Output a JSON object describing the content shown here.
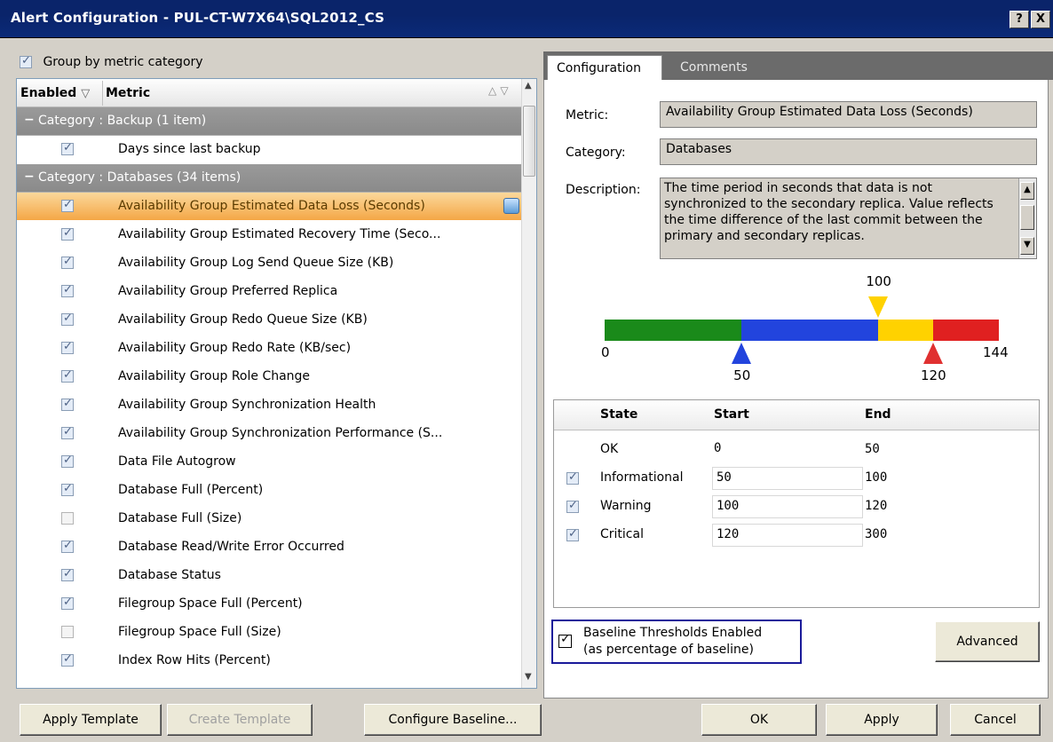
{
  "window": {
    "title": "Alert Configuration - PUL-CT-W7X64\\SQL2012_CS",
    "help_label": "?",
    "close_label": "X"
  },
  "left": {
    "group_by_label": "Group by metric category",
    "group_by_checked": true,
    "columns": {
      "enabled": "Enabled",
      "metric": "Metric"
    },
    "categories": [
      {
        "label": "Category : Backup (1 item)"
      },
      {
        "label": "Category : Databases (34 items)"
      }
    ],
    "backup_items": [
      {
        "name": "Days since last backup",
        "enabled": true
      }
    ],
    "database_items": [
      {
        "name": "Availability Group Estimated Data Loss (Seconds)",
        "enabled": true,
        "selected": true
      },
      {
        "name": "Availability Group Estimated Recovery Time (Seco...",
        "enabled": true
      },
      {
        "name": "Availability Group Log Send Queue Size (KB)",
        "enabled": true
      },
      {
        "name": "Availability Group Preferred Replica",
        "enabled": true
      },
      {
        "name": "Availability Group Redo Queue Size (KB)",
        "enabled": true
      },
      {
        "name": "Availability Group Redo Rate (KB/sec)",
        "enabled": true
      },
      {
        "name": "Availability Group Role Change",
        "enabled": true
      },
      {
        "name": "Availability Group Synchronization Health",
        "enabled": true
      },
      {
        "name": "Availability Group Synchronization Performance (S...",
        "enabled": true
      },
      {
        "name": "Data File Autogrow",
        "enabled": true
      },
      {
        "name": "Database Full (Percent)",
        "enabled": true
      },
      {
        "name": "Database Full (Size)",
        "enabled": false
      },
      {
        "name": "Database Read/Write Error Occurred",
        "enabled": true
      },
      {
        "name": "Database Status",
        "enabled": true
      },
      {
        "name": "Filegroup Space Full (Percent)",
        "enabled": true
      },
      {
        "name": "Filegroup Space Full (Size)",
        "enabled": false
      },
      {
        "name": "Index Row Hits (Percent)",
        "enabled": true
      }
    ]
  },
  "tabs": [
    {
      "label": "Configuration",
      "active": true
    },
    {
      "label": "Comments",
      "active": false
    }
  ],
  "config": {
    "metric_label": "Metric:",
    "metric_value": "Availability Group Estimated Data Loss (Seconds)",
    "category_label": "Category:",
    "category_value": "Databases",
    "description_label": "Description:",
    "description_value": "The time period in seconds that data is not synchronized to the secondary replica.  Value reflects the time difference of the last commit between the primary and secondary replicas."
  },
  "threshold": {
    "min": 0,
    "max": 144,
    "informational": 50,
    "warning": 100,
    "critical": 120,
    "labels": {
      "min": "0",
      "max": "144",
      "informational": "50",
      "warning": "100",
      "critical": "120"
    },
    "colors": {
      "ok": "#1a8a1a",
      "informational": "#2244dd",
      "warning": "#ffd200",
      "critical": "#e02020"
    }
  },
  "states_table": {
    "headers": {
      "state": "State",
      "start": "Start",
      "end": "End"
    },
    "rows": [
      {
        "state": "OK",
        "start": "0",
        "end": "50",
        "has_check": false,
        "checked": false
      },
      {
        "state": "Informational",
        "start": "50",
        "end": "100",
        "has_check": true,
        "checked": true
      },
      {
        "state": "Warning",
        "start": "100",
        "end": "120",
        "has_check": true,
        "checked": true
      },
      {
        "state": "Critical",
        "start": "120",
        "end": "300",
        "has_check": true,
        "checked": true
      }
    ]
  },
  "baseline": {
    "line1": "Baseline Thresholds Enabled",
    "line2": "(as percentage of baseline)",
    "checked": true
  },
  "buttons": {
    "advanced": "Advanced",
    "apply_template": "Apply Template",
    "create_template": "Create Template",
    "configure_baseline": "Configure Baseline...",
    "ok": "OK",
    "apply": "Apply",
    "cancel": "Cancel"
  }
}
